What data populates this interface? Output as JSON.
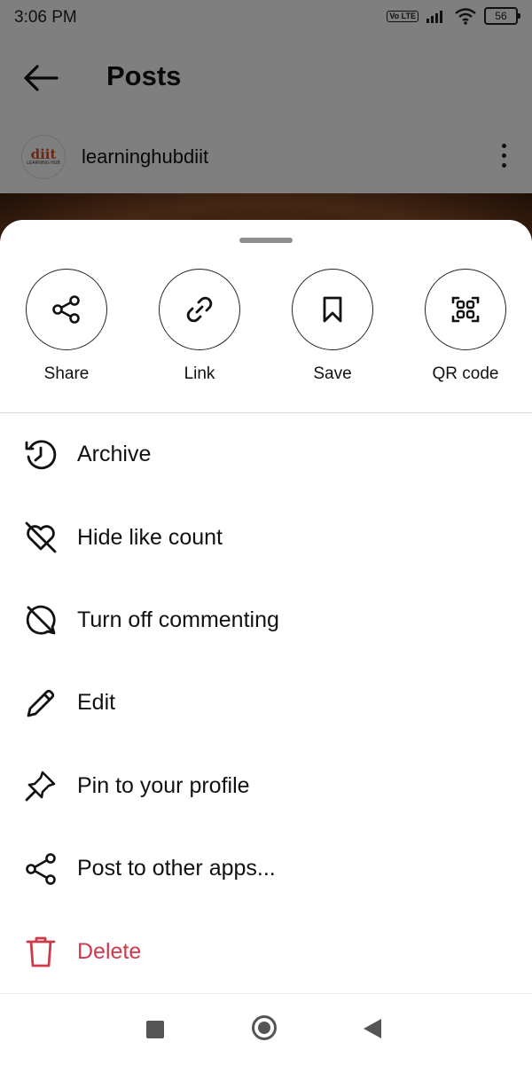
{
  "status_bar": {
    "time": "3:06 PM",
    "volte": "Vo LTE",
    "battery": "56"
  },
  "header": {
    "title": "Posts"
  },
  "post": {
    "username": "learninghubdiit",
    "avatar_brand": "diit",
    "avatar_sub": "LEARNING HUB"
  },
  "sheet": {
    "actions": [
      {
        "label": "Share",
        "icon": "share-icon"
      },
      {
        "label": "Link",
        "icon": "link-icon"
      },
      {
        "label": "Save",
        "icon": "bookmark-icon"
      },
      {
        "label": "QR code",
        "icon": "qr-code-icon"
      }
    ],
    "menu": [
      {
        "label": "Archive",
        "icon": "archive-clock-icon"
      },
      {
        "label": "Hide like count",
        "icon": "heart-off-icon"
      },
      {
        "label": "Turn off commenting",
        "icon": "comment-off-icon"
      },
      {
        "label": "Edit",
        "icon": "pencil-icon"
      },
      {
        "label": "Pin to your profile",
        "icon": "pin-icon"
      },
      {
        "label": "Post to other apps...",
        "icon": "share-icon"
      },
      {
        "label": "Delete",
        "icon": "trash-icon"
      }
    ]
  },
  "colors": {
    "danger": "#cf3a4b",
    "scrim": "rgba(0,0,0,0.5)"
  }
}
